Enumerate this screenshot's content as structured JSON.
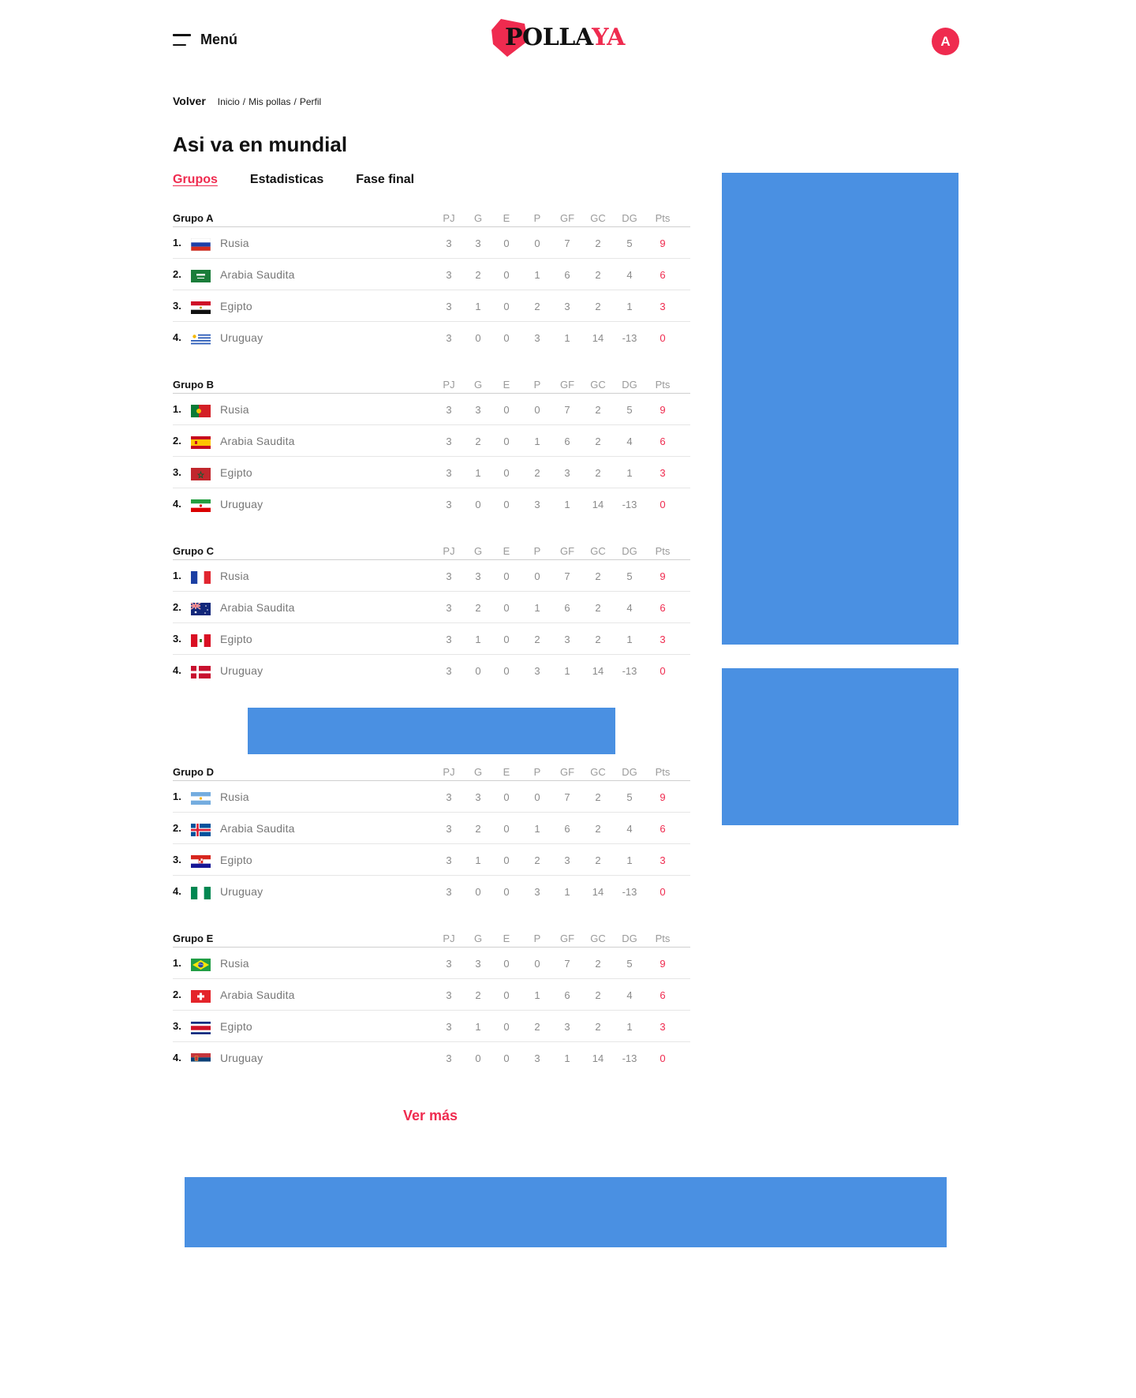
{
  "header": {
    "menu_label": "Menú",
    "logo_part1": "POLLA",
    "logo_part2": "YA",
    "avatar_initial": "A",
    "accent_color": "#ef2b4f"
  },
  "breadcrumb": {
    "back_label": "Volver",
    "items": [
      "Inicio",
      "Mis pollas",
      "Perfil"
    ],
    "separator": "/"
  },
  "page_title": "Asi va en mundial",
  "tabs": [
    {
      "label": "Grupos",
      "active": true
    },
    {
      "label": "Estadisticas",
      "active": false
    },
    {
      "label": "Fase final",
      "active": false
    }
  ],
  "columns": [
    "PJ",
    "G",
    "E",
    "P",
    "GF",
    "GC",
    "DG",
    "Pts"
  ],
  "groups": [
    {
      "name": "Grupo A",
      "rows": [
        {
          "pos": "1.",
          "flag": "russia-flag-icon",
          "team": "Rusia",
          "stats": [
            "3",
            "3",
            "0",
            "0",
            "7",
            "2",
            "5",
            "9"
          ]
        },
        {
          "pos": "2.",
          "flag": "saudi-arabia-flag-icon",
          "team": "Arabia Saudita",
          "stats": [
            "3",
            "2",
            "0",
            "1",
            "6",
            "2",
            "4",
            "6"
          ]
        },
        {
          "pos": "3.",
          "flag": "egypt-flag-icon",
          "team": "Egipto",
          "stats": [
            "3",
            "1",
            "0",
            "2",
            "3",
            "2",
            "1",
            "3"
          ]
        },
        {
          "pos": "4.",
          "flag": "uruguay-flag-icon",
          "team": "Uruguay",
          "stats": [
            "3",
            "0",
            "0",
            "3",
            "1",
            "14",
            "-13",
            "0"
          ]
        }
      ]
    },
    {
      "name": "Grupo B",
      "rows": [
        {
          "pos": "1.",
          "flag": "portugal-flag-icon",
          "team": "Rusia",
          "stats": [
            "3",
            "3",
            "0",
            "0",
            "7",
            "2",
            "5",
            "9"
          ]
        },
        {
          "pos": "2.",
          "flag": "spain-flag-icon",
          "team": "Arabia Saudita",
          "stats": [
            "3",
            "2",
            "0",
            "1",
            "6",
            "2",
            "4",
            "6"
          ]
        },
        {
          "pos": "3.",
          "flag": "morocco-flag-icon",
          "team": "Egipto",
          "stats": [
            "3",
            "1",
            "0",
            "2",
            "3",
            "2",
            "1",
            "3"
          ]
        },
        {
          "pos": "4.",
          "flag": "iran-flag-icon",
          "team": "Uruguay",
          "stats": [
            "3",
            "0",
            "0",
            "3",
            "1",
            "14",
            "-13",
            "0"
          ]
        }
      ]
    },
    {
      "name": "Grupo C",
      "rows": [
        {
          "pos": "1.",
          "flag": "france-flag-icon",
          "team": "Rusia",
          "stats": [
            "3",
            "3",
            "0",
            "0",
            "7",
            "2",
            "5",
            "9"
          ]
        },
        {
          "pos": "2.",
          "flag": "australia-flag-icon",
          "team": "Arabia Saudita",
          "stats": [
            "3",
            "2",
            "0",
            "1",
            "6",
            "2",
            "4",
            "6"
          ]
        },
        {
          "pos": "3.",
          "flag": "peru-flag-icon",
          "team": "Egipto",
          "stats": [
            "3",
            "1",
            "0",
            "2",
            "3",
            "2",
            "1",
            "3"
          ]
        },
        {
          "pos": "4.",
          "flag": "denmark-flag-icon",
          "team": "Uruguay",
          "stats": [
            "3",
            "0",
            "0",
            "3",
            "1",
            "14",
            "-13",
            "0"
          ]
        }
      ]
    },
    {
      "name": "Grupo D",
      "rows": [
        {
          "pos": "1.",
          "flag": "argentina-flag-icon",
          "team": "Rusia",
          "stats": [
            "3",
            "3",
            "0",
            "0",
            "7",
            "2",
            "5",
            "9"
          ]
        },
        {
          "pos": "2.",
          "flag": "iceland-flag-icon",
          "team": "Arabia Saudita",
          "stats": [
            "3",
            "2",
            "0",
            "1",
            "6",
            "2",
            "4",
            "6"
          ]
        },
        {
          "pos": "3.",
          "flag": "croatia-flag-icon",
          "team": "Egipto",
          "stats": [
            "3",
            "1",
            "0",
            "2",
            "3",
            "2",
            "1",
            "3"
          ]
        },
        {
          "pos": "4.",
          "flag": "nigeria-flag-icon",
          "team": "Uruguay",
          "stats": [
            "3",
            "0",
            "0",
            "3",
            "1",
            "14",
            "-13",
            "0"
          ]
        }
      ]
    },
    {
      "name": "Grupo E",
      "rows": [
        {
          "pos": "1.",
          "flag": "brazil-flag-icon",
          "team": "Rusia",
          "stats": [
            "3",
            "3",
            "0",
            "0",
            "7",
            "2",
            "5",
            "9"
          ]
        },
        {
          "pos": "2.",
          "flag": "switzerland-flag-icon",
          "team": "Arabia Saudita",
          "stats": [
            "3",
            "2",
            "0",
            "1",
            "6",
            "2",
            "4",
            "6"
          ]
        },
        {
          "pos": "3.",
          "flag": "costa-rica-flag-icon",
          "team": "Egipto",
          "stats": [
            "3",
            "1",
            "0",
            "2",
            "3",
            "2",
            "1",
            "3"
          ]
        },
        {
          "pos": "4.",
          "flag": "serbia-flag-icon",
          "team": "Uruguay",
          "stats": [
            "3",
            "0",
            "0",
            "3",
            "1",
            "14",
            "-13",
            "0"
          ]
        }
      ]
    }
  ],
  "more_label": "Ver más",
  "ad_color": "#4a90e2"
}
